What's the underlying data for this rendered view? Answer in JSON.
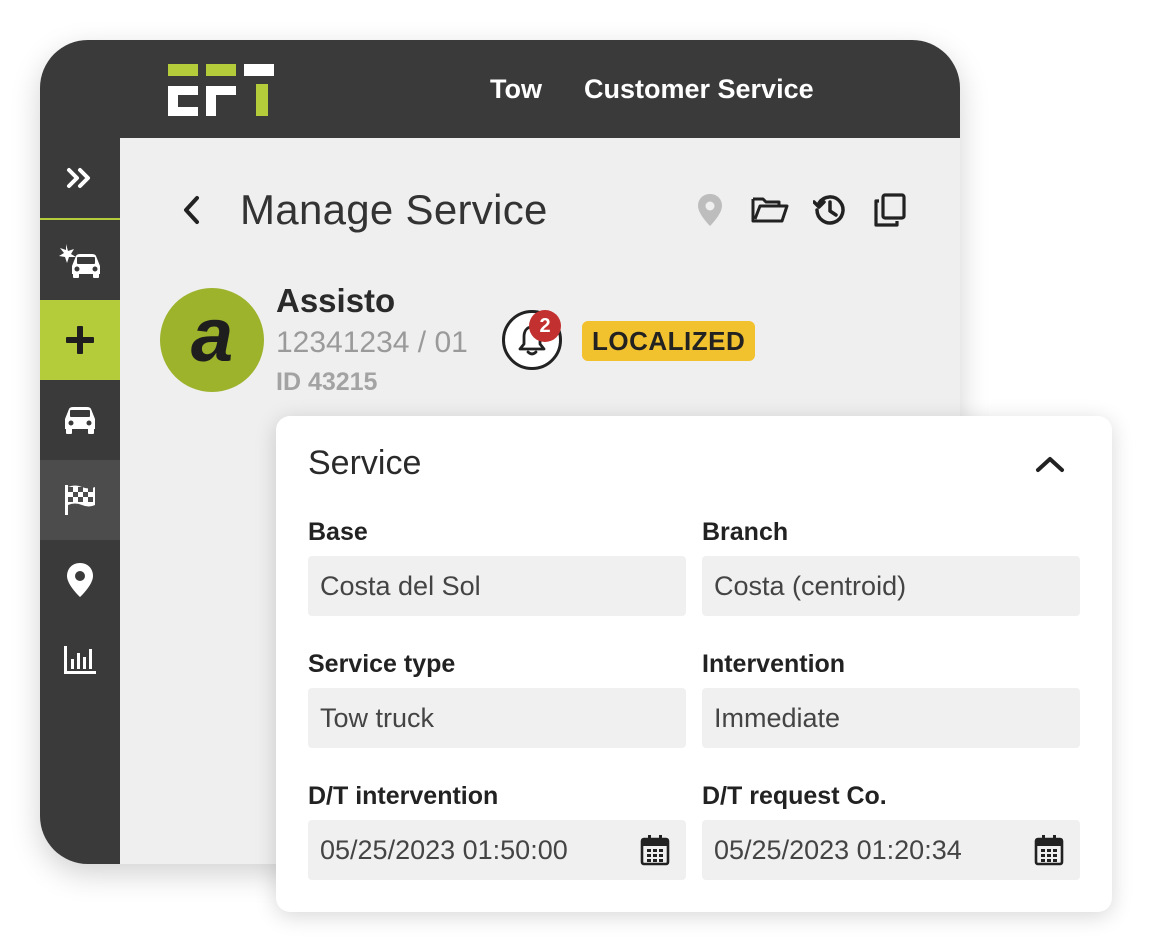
{
  "header": {
    "nav": [
      "Tow",
      "Customer Service"
    ]
  },
  "sidebar": {
    "items": [
      {
        "icon": "double-chevron-right-icon"
      },
      {
        "icon": "car-crash-icon"
      },
      {
        "icon": "plus-icon",
        "active": true
      },
      {
        "icon": "car-icon"
      },
      {
        "icon": "checkered-flag-icon"
      },
      {
        "icon": "map-pin-icon"
      },
      {
        "icon": "bar-chart-icon"
      }
    ]
  },
  "page": {
    "title": "Manage Service",
    "toolbar_icons": [
      "map-pin-icon",
      "folder-open-icon",
      "history-icon",
      "copy-icon"
    ]
  },
  "client": {
    "avatar_letter": "a",
    "name": "Assisto",
    "number": "12341234 / 01",
    "id": "ID 43215",
    "notifications": "2",
    "status": "LOCALIZED"
  },
  "service": {
    "title": "Service",
    "fields": {
      "base": {
        "label": "Base",
        "value": "Costa del Sol"
      },
      "branch": {
        "label": "Branch",
        "value": "Costa (centroid)"
      },
      "service_type": {
        "label": "Service type",
        "value": "Tow truck"
      },
      "intervention": {
        "label": "Intervention",
        "value": "Immediate"
      },
      "dt_intervention": {
        "label": "D/T intervention",
        "value": "05/25/2023 01:50:00"
      },
      "dt_request": {
        "label": "D/T request Co.",
        "value": "05/25/2023 01:20:34"
      }
    }
  },
  "colors": {
    "dark": "#3a3a3a",
    "accent": "#b5cc3a",
    "avatar": "#9cb32b",
    "status": "#f2c12e",
    "badge": "#c23030"
  }
}
